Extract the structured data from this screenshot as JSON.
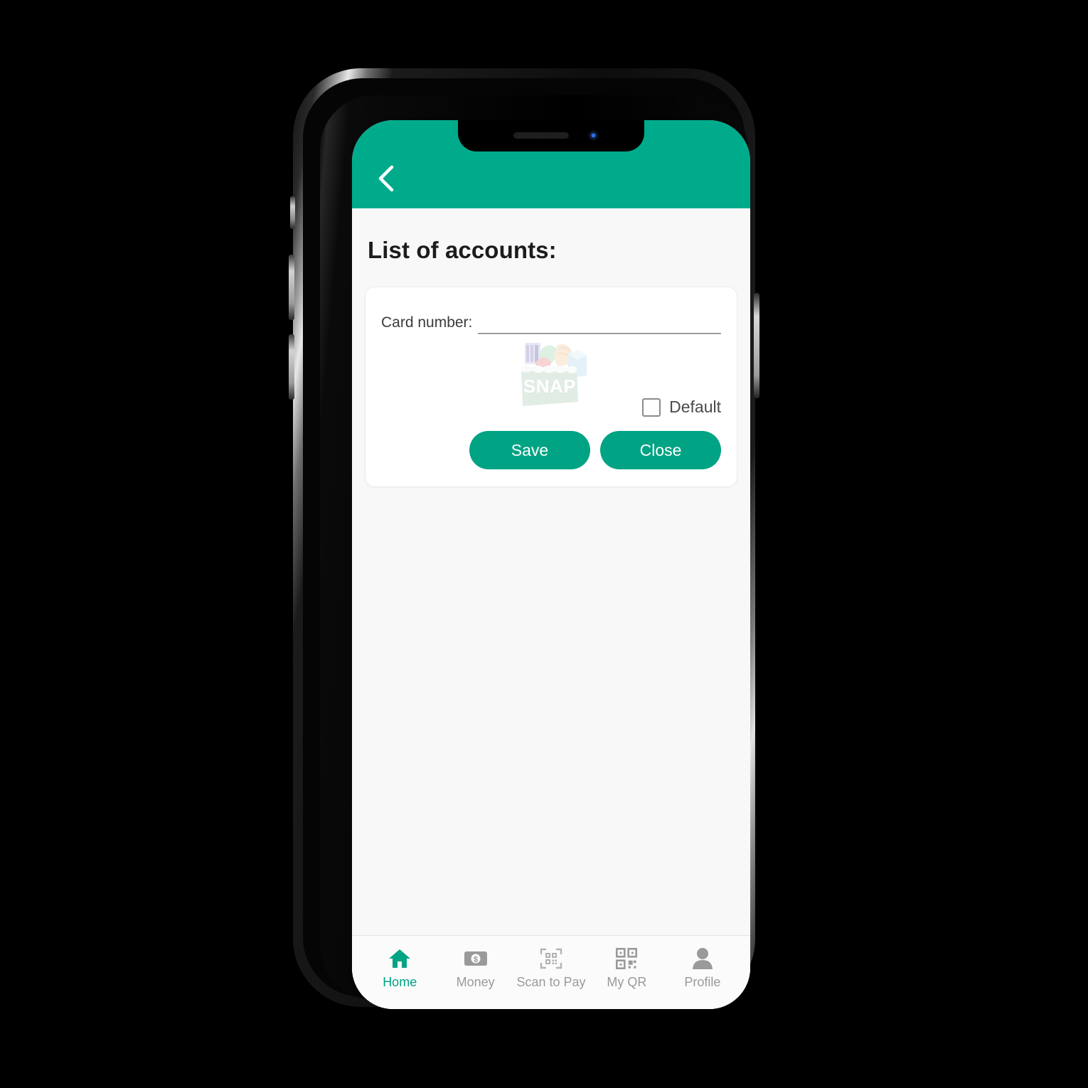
{
  "theme": {
    "header_teal": "#00ab8c",
    "button_teal": "#00a384",
    "active_nav_teal": "#00a384",
    "screen_bg": "#f8f8f8",
    "card_bg": "#ffffff",
    "muted_text": "#9a9a9a"
  },
  "header": {
    "back_icon": "chevron-left-icon"
  },
  "main": {
    "page_title": "List of accounts:",
    "card": {
      "card_number_label": "Card number:",
      "card_number_value": "",
      "card_number_placeholder": "",
      "logo": {
        "icon_name": "snap-logo",
        "text": "SNAP"
      },
      "default_checkbox": {
        "label": "Default",
        "checked": false
      },
      "save_label": "Save",
      "close_label": "Close"
    }
  },
  "bottom_nav": {
    "items": [
      {
        "label": "Home",
        "icon": "home-icon",
        "active": true
      },
      {
        "label": "Money",
        "icon": "banknote-icon",
        "active": false
      },
      {
        "label": "Scan to Pay",
        "icon": "qr-scan-icon",
        "active": false
      },
      {
        "label": "My QR",
        "icon": "qr-code-icon",
        "active": false
      },
      {
        "label": "Profile",
        "icon": "person-icon",
        "active": false
      }
    ]
  }
}
